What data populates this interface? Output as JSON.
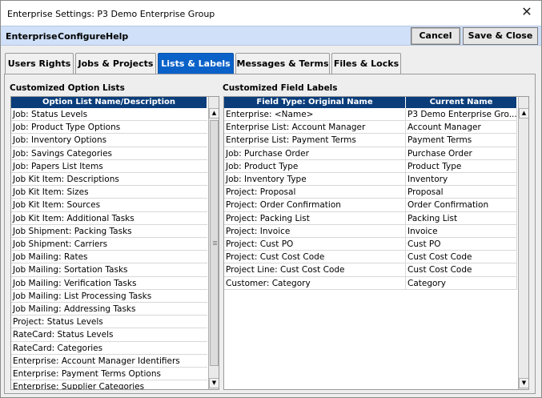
{
  "window": {
    "title": "Enterprise Settings: P3 Demo Enterprise Group",
    "close_glyph": "✕"
  },
  "menubar": {
    "items": [
      "Enterprise",
      "Configure",
      "Help"
    ],
    "cancel_label": "Cancel",
    "save_close_label": "Save & Close"
  },
  "tabs": [
    {
      "label": "Users Rights",
      "active": false
    },
    {
      "label": "Jobs & Projects",
      "active": false
    },
    {
      "label": "Lists & Labels",
      "active": true
    },
    {
      "label": "Messages & Terms",
      "active": false
    },
    {
      "label": "Files & Locks",
      "active": false
    }
  ],
  "option_lists": {
    "section_label": "Customized Option Lists",
    "column_header": "Option List Name/Description",
    "rows": [
      "Job: Status Levels",
      "Job: Product Type Options",
      "Job: Inventory Options",
      "Job: Savings Categories",
      "Job: Papers List Items",
      "Job Kit Item: Descriptions",
      "Job Kit Item: Sizes",
      "Job Kit Item: Sources",
      "Job Kit Item: Additional Tasks",
      "Job Shipment: Packing Tasks",
      "Job Shipment: Carriers",
      "Job Mailing: Rates",
      "Job Mailing: Sortation Tasks",
      "Job Mailing: Verification Tasks",
      "Job Mailing: List Processing Tasks",
      "Job Mailing: Addressing Tasks",
      "Project: Status Levels",
      "RateCard: Status Levels",
      "RateCard: Categories",
      "Enterprise: Account Manager Identifiers",
      "Enterprise: Payment Terms Options",
      "Enterprise: Supplier Categories"
    ]
  },
  "field_labels": {
    "section_label": "Customized Field Labels",
    "column_headers": [
      "Field Type: Original Name",
      "Current Name"
    ],
    "rows": [
      [
        "Enterprise: <Name>",
        "P3 Demo Enterprise Gro..."
      ],
      [
        "Enterprise List: Account Manager",
        "Account Manager"
      ],
      [
        "Enterprise List: Payment Terms",
        "Payment Terms"
      ],
      [
        "Job: Purchase Order",
        "Purchase Order"
      ],
      [
        "Job: Product Type",
        "Product Type"
      ],
      [
        "Job: Inventory Type",
        "Inventory"
      ],
      [
        "Project: Proposal",
        "Proposal"
      ],
      [
        "Project: Order Confirmation",
        "Order Confirmation"
      ],
      [
        "Project: Packing List",
        "Packing List"
      ],
      [
        "Project: Invoice",
        "Invoice"
      ],
      [
        "Project: Cust PO",
        "Cust PO"
      ],
      [
        "Project: Cust Cost Code",
        "Cust Cost Code"
      ],
      [
        "Project Line: Cust Cost Code",
        "Cust Cost Code"
      ],
      [
        "Customer: Category",
        "Category"
      ]
    ]
  },
  "scroll": {
    "up_glyph": "▲",
    "down_glyph": "▼"
  }
}
